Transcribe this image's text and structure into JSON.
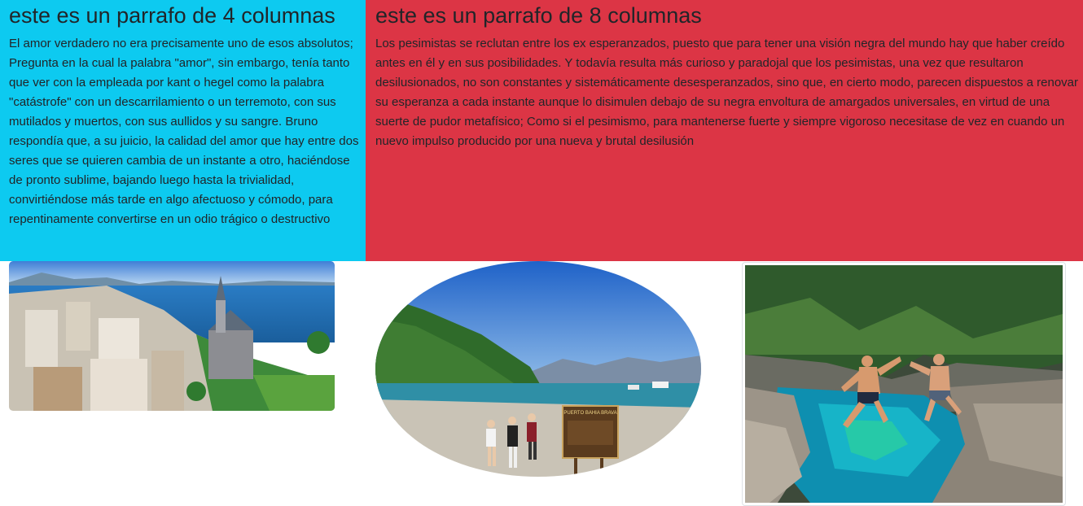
{
  "columns": {
    "col4": {
      "heading": "este es un parrafo de 4 columnas",
      "paragraph": "El amor verdadero no era precisamente uno de esos absolutos; Pregunta en la cual la palabra \"amor\", sin embargo, tenía tanto que ver con la empleada por kant o hegel como la palabra \"catástrofe\" con un descarrilamiento o un terremoto, con sus mutilados y muertos, con sus aullidos y su sangre. Bruno respondía que, a su juicio, la calidad del amor que hay entre dos seres que se quieren cambia de un instante a otro, haciéndose de pronto sublime, bajando luego hasta la trivialidad, convirtiéndose más tarde en algo afectuoso y cómodo, para repentinamente convertirse en un odio trágico o destructivo"
    },
    "col8": {
      "heading": "este es un parrafo de 8 columnas",
      "paragraph": "Los pesimistas se reclutan entre los ex esperanzados, puesto que para tener una visión negra del mundo hay que haber creído antes en él y en sus posibilidades. Y todavía resulta más curioso y paradojal que los pesimistas, una vez que resultaron desilusionados, no son constantes y sistemáticamente desesperanzados, sino que, en cierto modo, parecen dispuestos a renovar su esperanza a cada instante aunque lo disimulen debajo de su negra envoltura de amargados universales, en virtud de una suerte de pudor metafísico; Como si el pesimismo, para mantenerse fuerte y siempre vigoroso necesitase de vez en cuando un nuevo impulso producido por una nueva y brutal desilusión"
    }
  },
  "images": {
    "sign_text": "PUERTO BAHIA BRAVA"
  },
  "colors": {
    "info": "#0dcaf0",
    "danger": "#dc3545",
    "text": "#212529"
  }
}
